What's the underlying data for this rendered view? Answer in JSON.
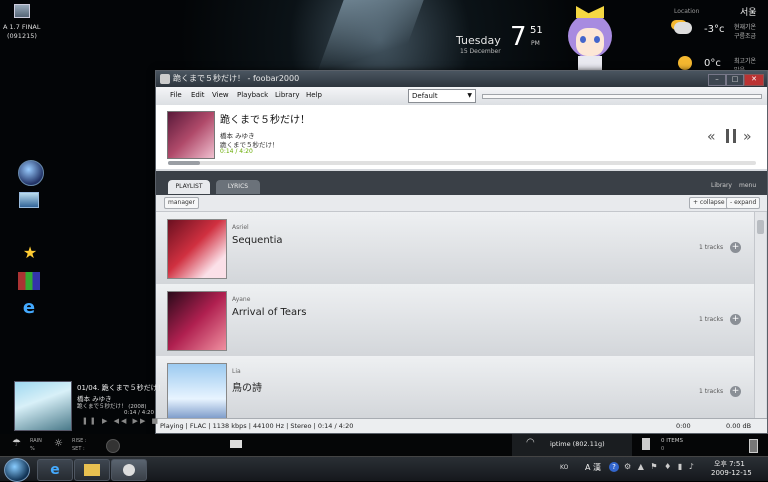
{
  "desktop": {
    "top_left_icon_label_1": "A 1.7 FINAL",
    "top_left_icon_label_2": "(091215)"
  },
  "clock": {
    "day": "Tuesday",
    "date": "15 December",
    "hour": "7",
    "minute": "51",
    "ampm": "PM"
  },
  "weather": {
    "city": "서울",
    "location_label": "Location",
    "current_label": "현재기온",
    "current_desc": "구름조금",
    "temp1": "-3°c",
    "temp2": "0°c",
    "low_label": "최고기온",
    "low_desc": "맑음"
  },
  "window": {
    "title": "跪くまで５秒だけ！ - foobar2000",
    "menu": [
      "File",
      "Edit",
      "View",
      "Playback",
      "Library",
      "Help"
    ],
    "preset": "Default"
  },
  "now_playing": {
    "title": "跪くまで５秒だけ！",
    "artist": "橋本 みゆき",
    "album": "跪くまで５秒だけ！",
    "time": "0:14 / 4:20",
    "progress": 0.054
  },
  "tabs": {
    "playlist": "PLAYLIST",
    "lyrics": "LYRICS",
    "library": "Library",
    "menu": "menu"
  },
  "toolbar": {
    "manager": "manager",
    "collapse": "+ collapse",
    "expand": "- expand"
  },
  "albums": [
    {
      "artist": "Asriel",
      "title": "Sequentia",
      "tracks": "1 tracks"
    },
    {
      "artist": "Ayane",
      "title": "Arrival of Tears",
      "tracks": "1 tracks"
    },
    {
      "artist": "Lia",
      "title": "鳥の詩",
      "tracks": "1 tracks"
    }
  ],
  "status": {
    "text": "Playing | FLAC | 1138 kbps | 44100 Hz | Stereo | 0:14 / 4:20",
    "time": "0:00",
    "db": "0.00 dB"
  },
  "mini_player": {
    "track": "01/04. 跪くまで５秒だけ！",
    "artist": "橋本 みゆき",
    "album": "跪くまで５秒だけ！ (2008)",
    "time": "0:14 / 4:20"
  },
  "gadgets": {
    "rain": "RAIN",
    "rain_val": "%",
    "rise": "RISE :",
    "set": "SET :",
    "wifi": "iptime  (802.11g)",
    "recycle": "0 ITEMS",
    "recycle_sub": "0"
  },
  "tray": {
    "lang": "KO",
    "ime": "A 漢",
    "ampm": "오후 7:51",
    "date": "2009-12-15"
  }
}
